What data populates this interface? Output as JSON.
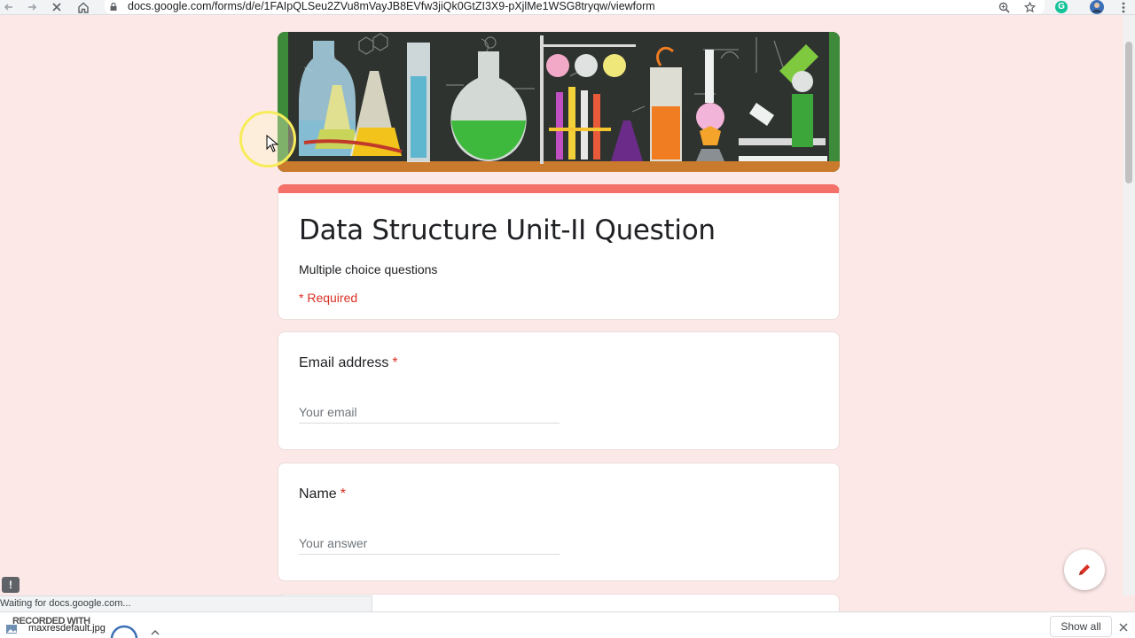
{
  "browser": {
    "url": "docs.google.com/forms/d/e/1FAIpQLSeu2ZVu8mVayJB8EVfw3jiQk0GtZI3X9-pXjlMe1WSG8tryqw/viewform",
    "status_text": "Waiting for docs.google.com...",
    "grammarly_icon": "G"
  },
  "form": {
    "title": "Data Structure Unit-II Question",
    "description": "Multiple choice questions",
    "required_note": "* Required",
    "accent_color": "#f4716a",
    "background_color": "#fce8e6",
    "questions": [
      {
        "label": "Email address",
        "required_mark": "*",
        "placeholder": "Your email"
      },
      {
        "label": "Name",
        "required_mark": "*",
        "placeholder": "Your answer"
      }
    ]
  },
  "downloads": {
    "item_name": "maxresdefault.jpg",
    "recorded_stamp": "RECORDED WITH",
    "show_all": "Show all"
  }
}
